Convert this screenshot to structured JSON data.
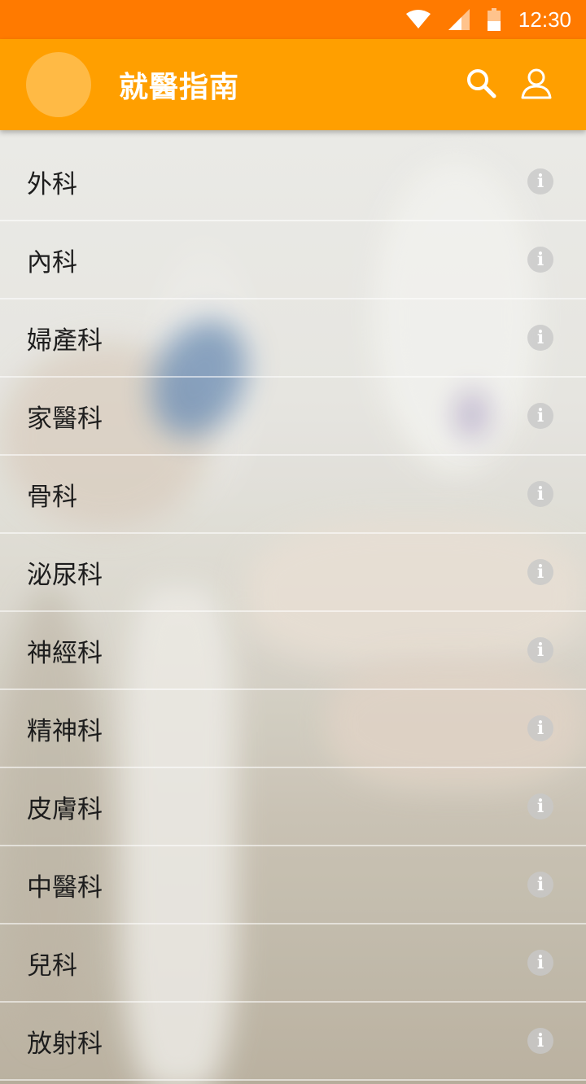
{
  "status_bar": {
    "time": "12:30",
    "icons": [
      "wifi-icon",
      "signal-icon",
      "battery-icon"
    ]
  },
  "app_bar": {
    "title": "就醫指南",
    "actions": [
      "search-icon",
      "profile-icon"
    ]
  },
  "colors": {
    "status_bar": "#ff7a00",
    "app_bar": "#ff9f00",
    "avatar": "#ffba45"
  },
  "departments": [
    {
      "label": "外科",
      "icon": "info-icon"
    },
    {
      "label": "內科",
      "icon": "info-icon"
    },
    {
      "label": "婦產科",
      "icon": "info-icon"
    },
    {
      "label": "家醫科",
      "icon": "info-icon"
    },
    {
      "label": "骨科",
      "icon": "info-icon"
    },
    {
      "label": "泌尿科",
      "icon": "info-icon"
    },
    {
      "label": "神經科",
      "icon": "info-icon"
    },
    {
      "label": "精神科",
      "icon": "info-icon"
    },
    {
      "label": "皮膚科",
      "icon": "info-icon"
    },
    {
      "label": "中醫科",
      "icon": "info-icon"
    },
    {
      "label": "兒科",
      "icon": "info-icon"
    },
    {
      "label": "放射科",
      "icon": "info-icon"
    }
  ]
}
